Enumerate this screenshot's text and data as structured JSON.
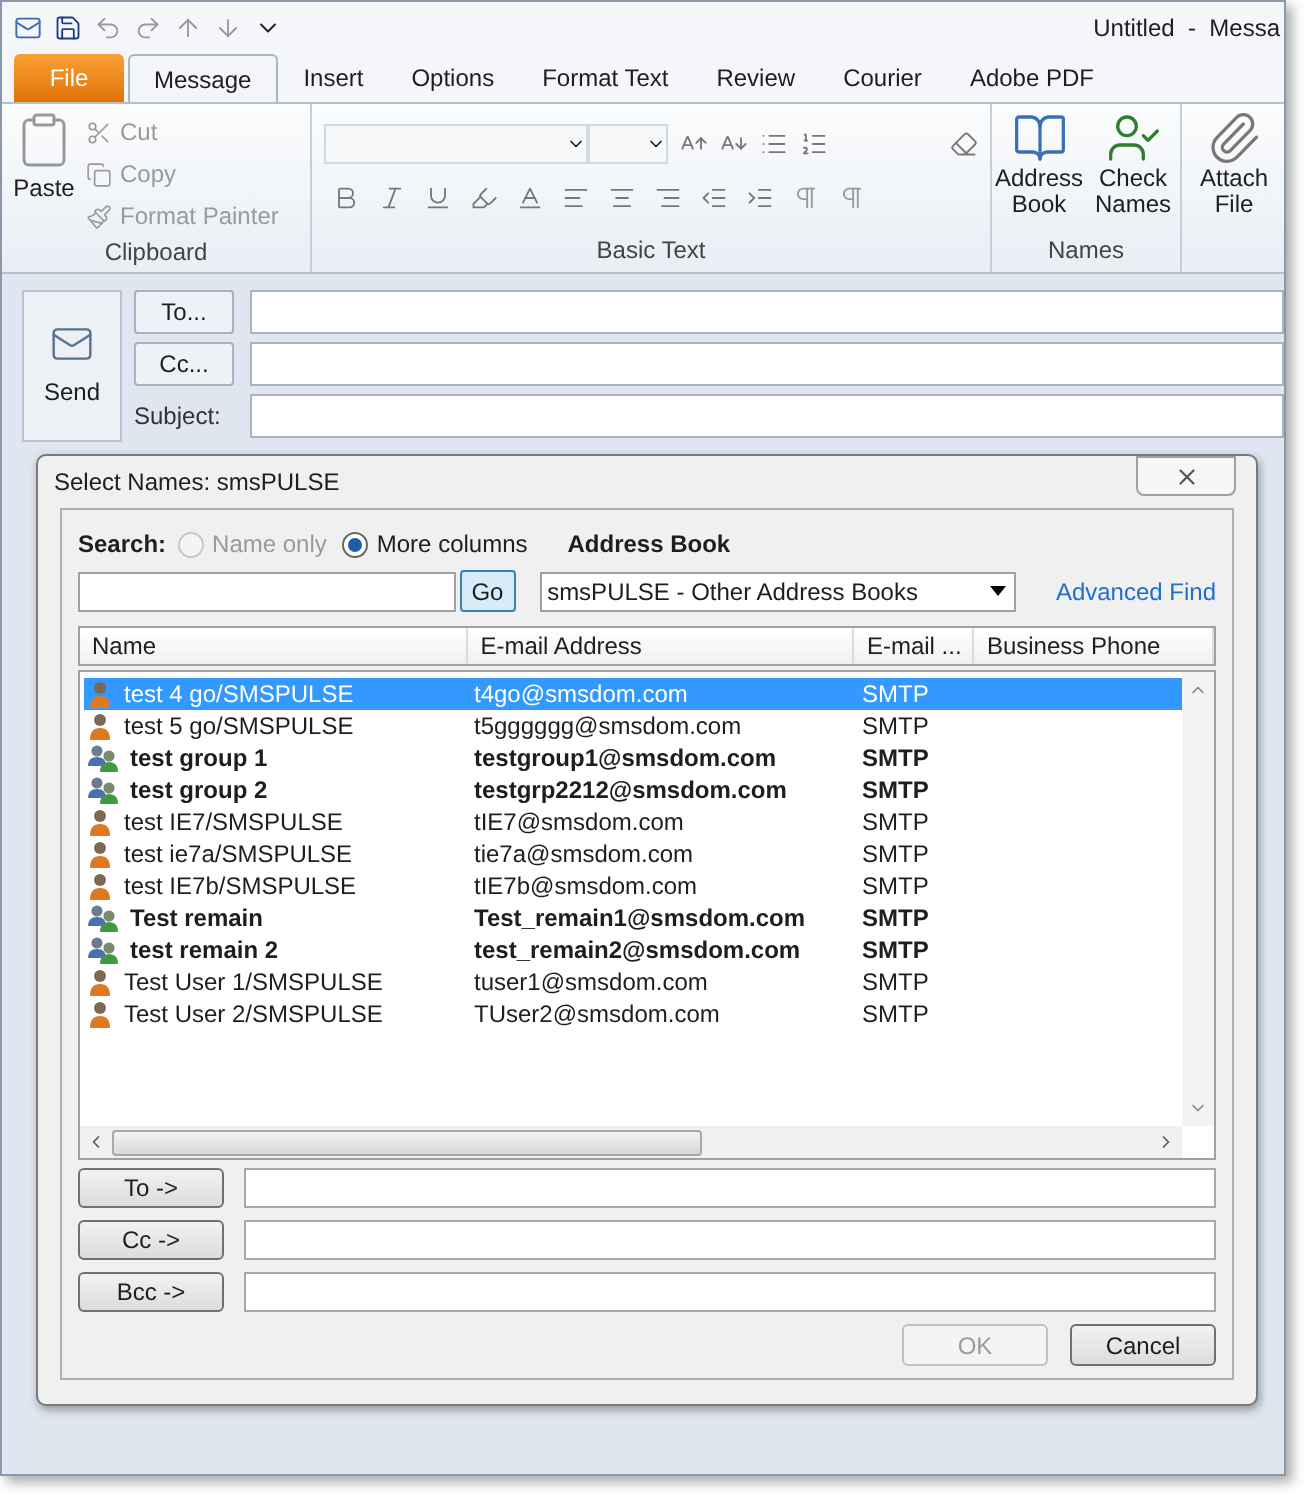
{
  "window": {
    "title": "Untitled  -  Messa"
  },
  "tabs": [
    {
      "label": "File",
      "kind": "file",
      "selected": false
    },
    {
      "label": "Message",
      "kind": "tab",
      "selected": true
    },
    {
      "label": "Insert",
      "kind": "tab",
      "selected": false
    },
    {
      "label": "Options",
      "kind": "tab",
      "selected": false
    },
    {
      "label": "Format Text",
      "kind": "tab",
      "selected": false
    },
    {
      "label": "Review",
      "kind": "tab",
      "selected": false
    },
    {
      "label": "Courier",
      "kind": "tab",
      "selected": false
    },
    {
      "label": "Adobe PDF",
      "kind": "tab",
      "selected": false
    }
  ],
  "ribbon": {
    "clipboard": {
      "label": "Clipboard",
      "paste": "Paste",
      "items": [
        {
          "label": "Cut",
          "disabled": true
        },
        {
          "label": "Copy",
          "disabled": true
        },
        {
          "label": "Format Painter",
          "disabled": true
        }
      ]
    },
    "basic_text": {
      "label": "Basic Text"
    },
    "names": {
      "label": "Names",
      "buttons": [
        "Address Book",
        "Check Names"
      ]
    },
    "attach": "Attach File"
  },
  "compose": {
    "send": "Send",
    "to": "To...",
    "cc": "Cc...",
    "subject": "Subject:"
  },
  "dialog": {
    "title": "Select Names: smsPULSE",
    "search_label": "Search:",
    "radios": [
      {
        "label": "Name only",
        "selected": false,
        "disabled": true
      },
      {
        "label": "More columns",
        "selected": true,
        "disabled": false
      }
    ],
    "address_book_label": "Address Book",
    "go": "Go",
    "address_book": "smsPULSE - Other Address Books",
    "advanced_find": "Advanced Find",
    "columns": [
      "Name",
      "E-mail Address",
      "E-mail ...",
      "Business Phone"
    ],
    "rows": [
      {
        "kind": "user",
        "name": "test 4 go/SMSPULSE",
        "email": "t4go@smsdom.com",
        "type": "SMTP",
        "selected": true
      },
      {
        "kind": "user",
        "name": "test 5 go/SMSPULSE",
        "email": "t5gggggg@smsdom.com",
        "type": "SMTP",
        "selected": false
      },
      {
        "kind": "group",
        "name": "test group 1",
        "email": "testgroup1@smsdom.com",
        "type": "SMTP",
        "selected": false
      },
      {
        "kind": "group",
        "name": "test group 2",
        "email": "testgrp2212@smsdom.com",
        "type": "SMTP",
        "selected": false
      },
      {
        "kind": "user",
        "name": "test IE7/SMSPULSE",
        "email": "tIE7@smsdom.com",
        "type": "SMTP",
        "selected": false
      },
      {
        "kind": "user",
        "name": "test ie7a/SMSPULSE",
        "email": "tie7a@smsdom.com",
        "type": "SMTP",
        "selected": false
      },
      {
        "kind": "user",
        "name": "test IE7b/SMSPULSE",
        "email": "tIE7b@smsdom.com",
        "type": "SMTP",
        "selected": false
      },
      {
        "kind": "group",
        "name": "Test remain",
        "email": "Test_remain1@smsdom.com",
        "type": "SMTP",
        "selected": false
      },
      {
        "kind": "group",
        "name": "test remain 2",
        "email": "test_remain2@smsdom.com",
        "type": "SMTP",
        "selected": false
      },
      {
        "kind": "user",
        "name": "Test User 1/SMSPULSE",
        "email": "tuser1@smsdom.com",
        "type": "SMTP",
        "selected": false
      },
      {
        "kind": "user",
        "name": "Test User 2/SMSPULSE",
        "email": "TUser2@smsdom.com",
        "type": "SMTP",
        "selected": false
      }
    ],
    "recipients": [
      "To ->",
      "Cc ->",
      "Bcc ->"
    ],
    "ok": {
      "label": "OK",
      "disabled": true
    },
    "cancel": "Cancel"
  }
}
